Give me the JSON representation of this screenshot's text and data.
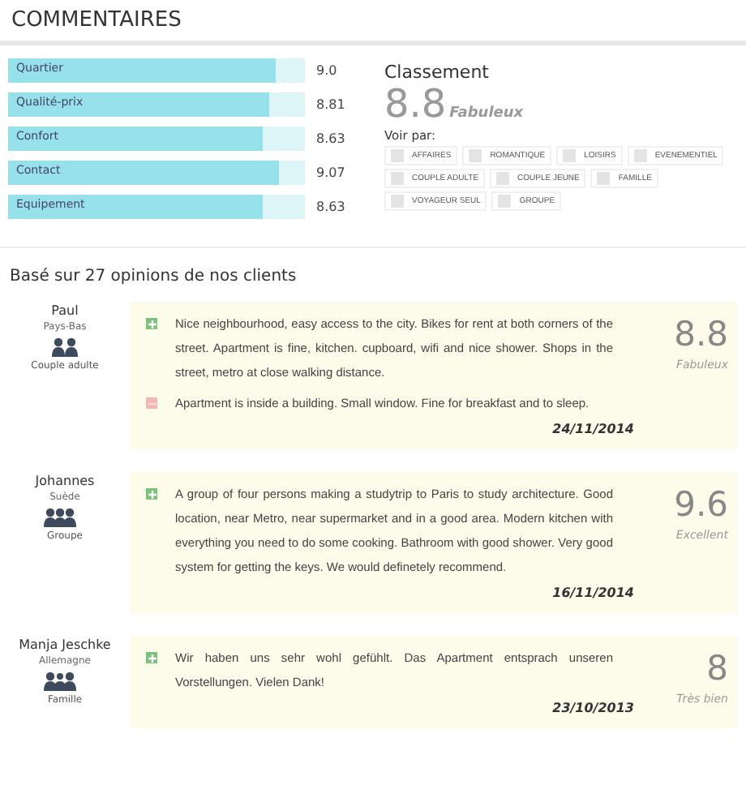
{
  "title": "COMMENTAIRES",
  "scores": [
    {
      "label": "Quartier",
      "level": 0.9,
      "value": "9.0"
    },
    {
      "label": "Qualité-prix",
      "level": 0.88,
      "value": "8.81"
    },
    {
      "label": "Confort",
      "level": 0.86,
      "value": "8.63"
    },
    {
      "label": "Contact",
      "level": 0.91,
      "value": "9.07"
    },
    {
      "label": "Equipement",
      "level": 0.86,
      "value": "8.63"
    }
  ],
  "ranking": {
    "title": "Classement",
    "score": "8.8",
    "verdict": "Fabuleux"
  },
  "filter": {
    "label": "Voir par:",
    "options": [
      {
        "label": "AFFAIRES",
        "checked": false
      },
      {
        "label": "ROMANTIQUE",
        "checked": false
      },
      {
        "label": "LOISIRS",
        "checked": false
      },
      {
        "label": "EVENEMENTIEL",
        "checked": false
      },
      {
        "label": "COUPLE ADULTE",
        "checked": false
      },
      {
        "label": "COUPLE JEUNE",
        "checked": false
      },
      {
        "label": "FAMILLE",
        "checked": false
      },
      {
        "label": "VOYAGEUR SEUL",
        "checked": false
      },
      {
        "label": "GROUPE",
        "checked": false
      }
    ]
  },
  "summary": "Basé sur 27 opinions de nos clients",
  "reviews": [
    {
      "name": "Paul",
      "country": "Pays-Bas",
      "traveler": {
        "kind": "couple",
        "label": "Couple adulte"
      },
      "comments": [
        {
          "kind": "pro",
          "text": "Nice neighbourhood, easy access to the city. Bikes for rent at both corners of the street. Apartment is fine, kitchen. cupboard, wifi and nice shower. Shops in the street, metro at close walking distance."
        },
        {
          "kind": "con",
          "text": "Apartment is inside a building. Small window. Fine for breakfast and to sleep."
        }
      ],
      "score": "8.8",
      "verdict": "Fabuleux",
      "date": "24/11/2014"
    },
    {
      "name": "Johannes",
      "country": "Suède",
      "traveler": {
        "kind": "group",
        "label": "Groupe"
      },
      "comments": [
        {
          "kind": "pro",
          "text": "A group of four persons making a studytrip to Paris to study architecture. Good location, near Metro, near supermarket and in a good area. Modern kitchen with everything you need to do some cooking. Bathroom with good shower. Very good system for getting the keys. We would definetely recommend."
        }
      ],
      "score": "9.6",
      "verdict": "Excellent",
      "date": "16/11/2014"
    },
    {
      "name": "Manja Jeschke",
      "country": "Allemagne",
      "traveler": {
        "kind": "family",
        "label": "Famille"
      },
      "comments": [
        {
          "kind": "pro",
          "text": "Wir haben uns sehr wohl gefühlt. Das Apartment entsprach unseren Vorstellungen. Vielen Dank!"
        }
      ],
      "score": "8",
      "verdict": "Très bien",
      "date": "23/10/2013"
    }
  ]
}
